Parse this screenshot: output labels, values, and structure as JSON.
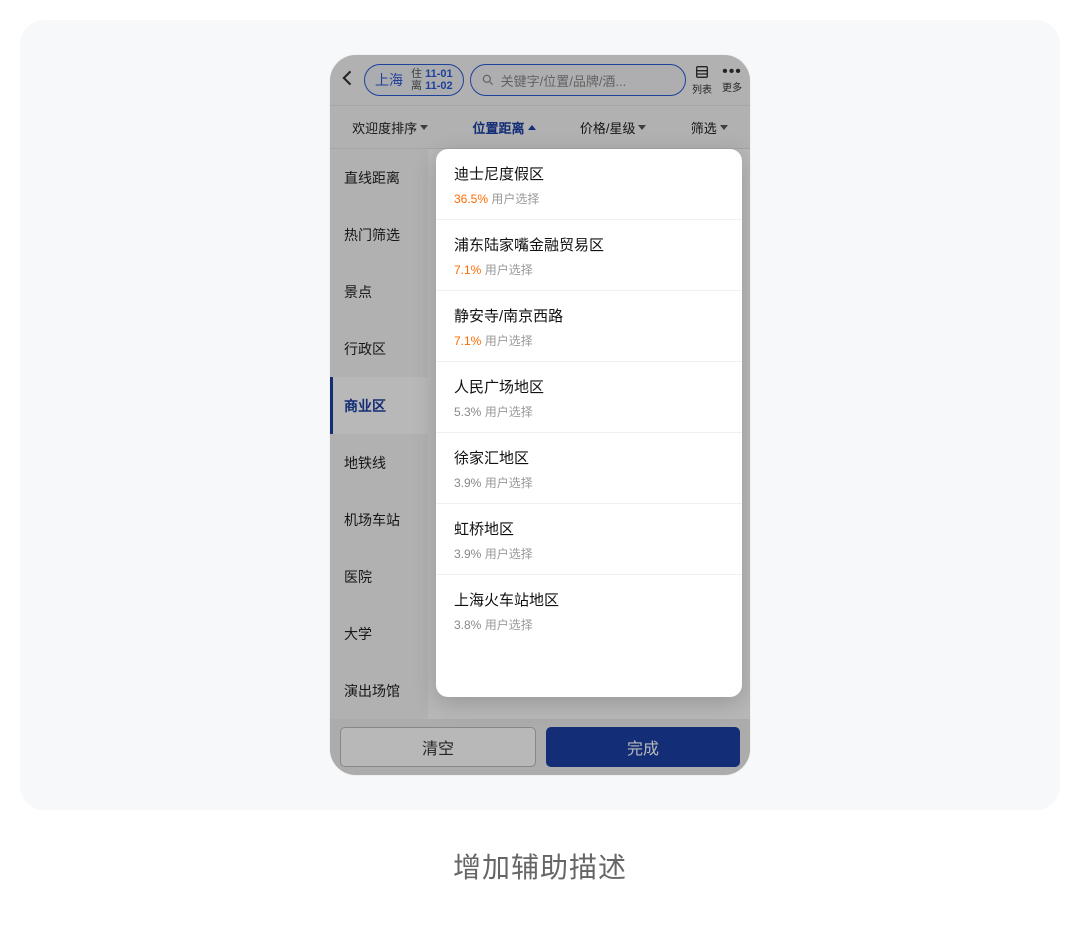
{
  "caption": "增加辅助描述",
  "topbar": {
    "city": "上海",
    "date_in_label": "住",
    "date_in": "11-01",
    "date_out_label": "离",
    "date_out": "11-02",
    "search_placeholder": "关键字/位置/品牌/酒...",
    "list_label": "列表",
    "more_label": "更多"
  },
  "filter_tabs": [
    {
      "label": "欢迎度排序",
      "active": false,
      "dir": "down"
    },
    {
      "label": "位置距离",
      "active": true,
      "dir": "up"
    },
    {
      "label": "价格/星级",
      "active": false,
      "dir": "down"
    },
    {
      "label": "筛选",
      "active": false,
      "dir": "down"
    }
  ],
  "sidebar": [
    {
      "label": "直线距离",
      "active": false
    },
    {
      "label": "热门筛选",
      "active": false
    },
    {
      "label": "景点",
      "active": false
    },
    {
      "label": "行政区",
      "active": false
    },
    {
      "label": "商业区",
      "active": true
    },
    {
      "label": "地铁线",
      "active": false
    },
    {
      "label": "机场车站",
      "active": false
    },
    {
      "label": "医院",
      "active": false
    },
    {
      "label": "大学",
      "active": false
    },
    {
      "label": "演出场馆",
      "active": false
    }
  ],
  "popup": [
    {
      "title": "迪士尼度假区",
      "pct": "36.5%",
      "suffix": "用户选择",
      "hot": true
    },
    {
      "title": "浦东陆家嘴金融贸易区",
      "pct": "7.1%",
      "suffix": "用户选择",
      "hot": true
    },
    {
      "title": "静安寺/南京西路",
      "pct": "7.1%",
      "suffix": "用户选择",
      "hot": true
    },
    {
      "title": "人民广场地区",
      "pct": "5.3%",
      "suffix": "用户选择",
      "hot": false
    },
    {
      "title": "徐家汇地区",
      "pct": "3.9%",
      "suffix": "用户选择",
      "hot": false
    },
    {
      "title": "虹桥地区",
      "pct": "3.9%",
      "suffix": "用户选择",
      "hot": false
    },
    {
      "title": "上海火车站地区",
      "pct": "3.8%",
      "suffix": "用户选择",
      "hot": false
    }
  ],
  "bottom": {
    "clear": "清空",
    "done": "完成"
  }
}
